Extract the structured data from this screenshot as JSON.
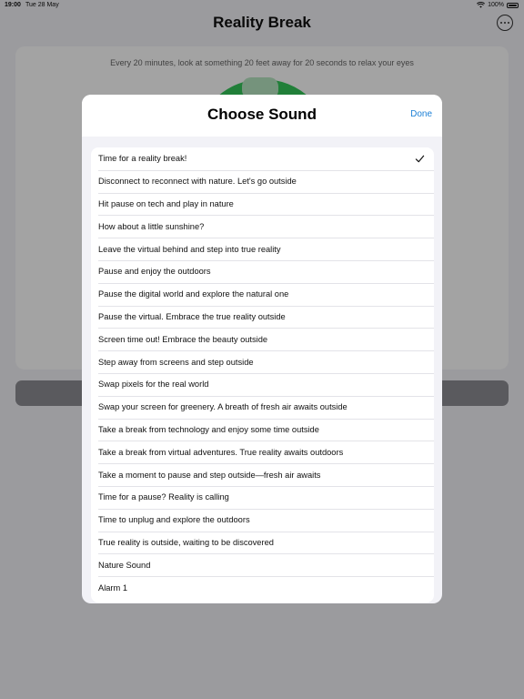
{
  "status_bar": {
    "time": "19:00",
    "date": "Tue 28 May",
    "battery": "100%"
  },
  "app": {
    "title": "Reality Break",
    "hint": "Every 20 minutes, look at something 20 feet away for 20 seconds to relax your eyes"
  },
  "modal": {
    "title": "Choose Sound",
    "done_label": "Done",
    "selected_index": 0,
    "sounds": [
      "Time for a reality break!",
      "Disconnect to reconnect with nature. Let's go outside",
      "Hit pause on tech and play in nature",
      "How about a little sunshine?",
      "Leave the virtual behind and step into true reality",
      "Pause and enjoy the outdoors",
      "Pause the digital world and explore the natural one",
      "Pause the virtual. Embrace the true reality outside",
      "Screen time out! Embrace the beauty outside",
      "Step away from screens and step outside",
      "Swap pixels for the real world",
      "Swap your screen for greenery. A breath of fresh air awaits outside",
      "Take a break from technology and enjoy some time outside",
      "Take a break from virtual adventures. True reality awaits outdoors",
      "Take a moment to pause and step outside—fresh air awaits",
      "Time for a pause? Reality is calling",
      "Time to unplug and explore the outdoors",
      "True reality is outside, waiting to be discovered",
      "Nature Sound",
      "Alarm 1"
    ]
  },
  "icons": {
    "more": "ellipsis-circle-icon",
    "wifi": "wifi-icon",
    "battery": "battery-icon",
    "check": "checkmark-icon"
  },
  "colors": {
    "accent": "#1a7fd6",
    "ring": "#34c759"
  }
}
